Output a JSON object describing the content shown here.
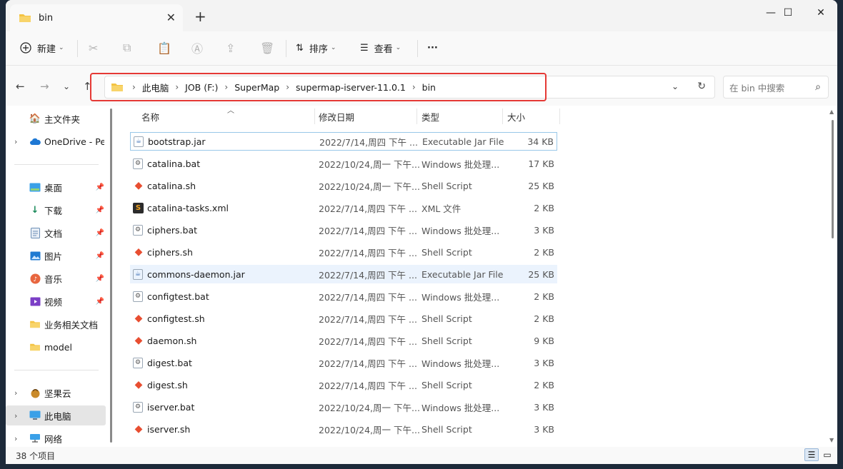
{
  "titlebar": {
    "tab_label": "bin",
    "tab_close": "✕",
    "new_tab": "+",
    "minimize": "—",
    "maximize": "☐",
    "close": "✕"
  },
  "toolbar": {
    "new_label": "新建",
    "sort_label": "排序",
    "view_label": "查看",
    "more": "···"
  },
  "address": {
    "crumbs": [
      "此电脑",
      "JOB (F:)",
      "SuperMap",
      "supermap-iserver-11.0.1",
      "bin"
    ],
    "search_placeholder": "在 bin 中搜索"
  },
  "sidebar": {
    "items": [
      {
        "label": "主文件夹",
        "icon": "home-icon"
      },
      {
        "label": "OneDrive - Per",
        "icon": "cloud-icon"
      },
      {
        "label": "桌面",
        "icon": "desktop-icon"
      },
      {
        "label": "下载",
        "icon": "download-icon"
      },
      {
        "label": "文档",
        "icon": "document-icon"
      },
      {
        "label": "图片",
        "icon": "picture-icon"
      },
      {
        "label": "音乐",
        "icon": "music-icon"
      },
      {
        "label": "视频",
        "icon": "video-icon"
      },
      {
        "label": "业务相关文档",
        "icon": "folder-icon"
      },
      {
        "label": "model",
        "icon": "folder-icon"
      },
      {
        "label": "坚果云",
        "icon": "nut-cloud-icon"
      },
      {
        "label": "此电脑",
        "icon": "computer-icon"
      },
      {
        "label": "网络",
        "icon": "network-icon"
      }
    ]
  },
  "columns": {
    "name": "名称",
    "date": "修改日期",
    "type": "类型",
    "size": "大小"
  },
  "files": [
    {
      "name": "bootstrap.jar",
      "date": "2022/7/14,周四 下午 ...",
      "type": "Executable Jar File",
      "size": "34 KB",
      "kind": "jar"
    },
    {
      "name": "catalina.bat",
      "date": "2022/10/24,周一 下午...",
      "type": "Windows 批处理...",
      "size": "17 KB",
      "kind": "bat"
    },
    {
      "name": "catalina.sh",
      "date": "2022/10/24,周一 下午...",
      "type": "Shell Script",
      "size": "25 KB",
      "kind": "sh"
    },
    {
      "name": "catalina-tasks.xml",
      "date": "2022/7/14,周四 下午 ...",
      "type": "XML 文件",
      "size": "2 KB",
      "kind": "xml"
    },
    {
      "name": "ciphers.bat",
      "date": "2022/7/14,周四 下午 ...",
      "type": "Windows 批处理...",
      "size": "3 KB",
      "kind": "bat"
    },
    {
      "name": "ciphers.sh",
      "date": "2022/7/14,周四 下午 ...",
      "type": "Shell Script",
      "size": "2 KB",
      "kind": "sh"
    },
    {
      "name": "commons-daemon.jar",
      "date": "2022/7/14,周四 下午 ...",
      "type": "Executable Jar File",
      "size": "25 KB",
      "kind": "jar"
    },
    {
      "name": "configtest.bat",
      "date": "2022/7/14,周四 下午 ...",
      "type": "Windows 批处理...",
      "size": "2 KB",
      "kind": "bat"
    },
    {
      "name": "configtest.sh",
      "date": "2022/7/14,周四 下午 ...",
      "type": "Shell Script",
      "size": "2 KB",
      "kind": "sh"
    },
    {
      "name": "daemon.sh",
      "date": "2022/7/14,周四 下午 ...",
      "type": "Shell Script",
      "size": "9 KB",
      "kind": "sh"
    },
    {
      "name": "digest.bat",
      "date": "2022/7/14,周四 下午 ...",
      "type": "Windows 批处理...",
      "size": "3 KB",
      "kind": "bat"
    },
    {
      "name": "digest.sh",
      "date": "2022/7/14,周四 下午 ...",
      "type": "Shell Script",
      "size": "2 KB",
      "kind": "sh"
    },
    {
      "name": "iserver.bat",
      "date": "2022/10/24,周一 下午...",
      "type": "Windows 批处理...",
      "size": "3 KB",
      "kind": "bat"
    },
    {
      "name": "iserver.sh",
      "date": "2022/10/24,周一 下午...",
      "type": "Shell Script",
      "size": "3 KB",
      "kind": "sh"
    }
  ],
  "status": {
    "count": "38 个项目"
  },
  "colors": {
    "highlight_border": "#e53935",
    "selection_bg": "#ebf3fd",
    "folder": "#f4c343"
  }
}
